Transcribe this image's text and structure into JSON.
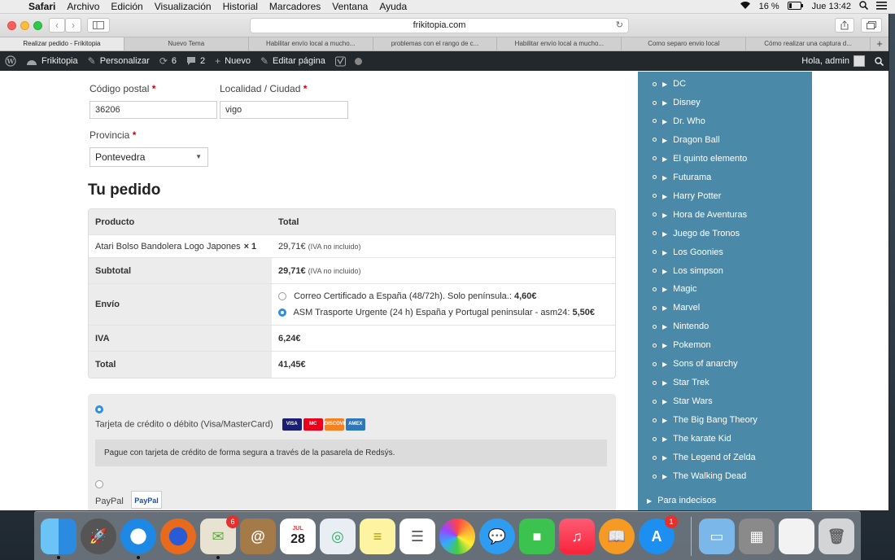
{
  "menubar": {
    "app": "Safari",
    "menus": [
      "Archivo",
      "Edición",
      "Visualización",
      "Historial",
      "Marcadores",
      "Ventana",
      "Ayuda"
    ],
    "battery": "16 %",
    "clock": "Jue 13:42"
  },
  "browser": {
    "url": "frikitopia.com",
    "tabs": [
      {
        "label": "Realizar pedido - Frikitopia",
        "active": true
      },
      {
        "label": "Nuevo Tema",
        "active": false
      },
      {
        "label": "Habilitar envío local a mucho...",
        "active": false
      },
      {
        "label": "problemas con el rango de c...",
        "active": false
      },
      {
        "label": "Habilitar envío local a mucho...",
        "active": false
      },
      {
        "label": "Como separo envio local",
        "active": false
      },
      {
        "label": "Cómo realizar una captura d...",
        "active": false
      }
    ],
    "new_tab": "+"
  },
  "wpbar": {
    "site": "Frikitopia",
    "customize": "Personalizar",
    "updates": "6",
    "comments": "2",
    "new": "Nuevo",
    "edit": "Editar página",
    "greeting": "Hola, admin"
  },
  "form": {
    "postcode_label": "Código postal",
    "postcode_value": "36206",
    "city_label": "Localidad / Ciudad",
    "city_value": "vigo",
    "province_label": "Provincia",
    "province_value": "Pontevedra",
    "required_mark": "*"
  },
  "order": {
    "heading": "Tu pedido",
    "col_product": "Producto",
    "col_total": "Total",
    "item_name": "Atari Bolso Bandolera Logo Japones",
    "item_qty": "× 1",
    "item_price": "29,71€",
    "tax_note": "(IVA no incluido)",
    "subtotal_label": "Subtotal",
    "subtotal_value": "29,71€",
    "shipping_label": "Envío",
    "shipping_opt1_text": "Correo Certificado a España (48/72h). Solo península.:",
    "shipping_opt1_price": "4,60€",
    "shipping_opt2_text": "ASM Trasporte Urgente (24 h) España y Portugal peninsular - asm24:",
    "shipping_opt2_price": "5,50€",
    "iva_label": "IVA",
    "iva_value": "6,24€",
    "total_label": "Total",
    "total_value": "41,45€"
  },
  "payment": {
    "card_label": "Tarjeta de crédito o débito (Visa/MasterCard)",
    "card_logos": [
      "VISA",
      "MC",
      "DISCOVER",
      "AMEX"
    ],
    "card_desc": "Pague con tarjeta de crédito de forma segura a través de la pasarela de Redsýs.",
    "paypal_label": "PayPal",
    "paypal_logo": "PayPal"
  },
  "sidebar": {
    "items": [
      "DC",
      "Disney",
      "Dr. Who",
      "Dragon Ball",
      "El quinto elemento",
      "Futurama",
      "Harry Potter",
      "Hora de Aventuras",
      "Juego de Tronos",
      "Los Goonies",
      "Los simpson",
      "Magic",
      "Marvel",
      "Nintendo",
      "Pokemon",
      "Sons of anarchy",
      "Star Trek",
      "Star Wars",
      "The Big Bang Theory",
      "The karate Kid",
      "The Legend of Zelda",
      "The Walking Dead"
    ],
    "bottom_item": "Para indecisos"
  },
  "dock": {
    "calendar_month": "JUL",
    "calendar_day": "28",
    "mail_badge": "6",
    "appstore_badge": "1"
  },
  "colors": {
    "sidebar": "#4b89a9",
    "wpbar": "#23282d",
    "radio_selected": "#2e8ee6"
  }
}
